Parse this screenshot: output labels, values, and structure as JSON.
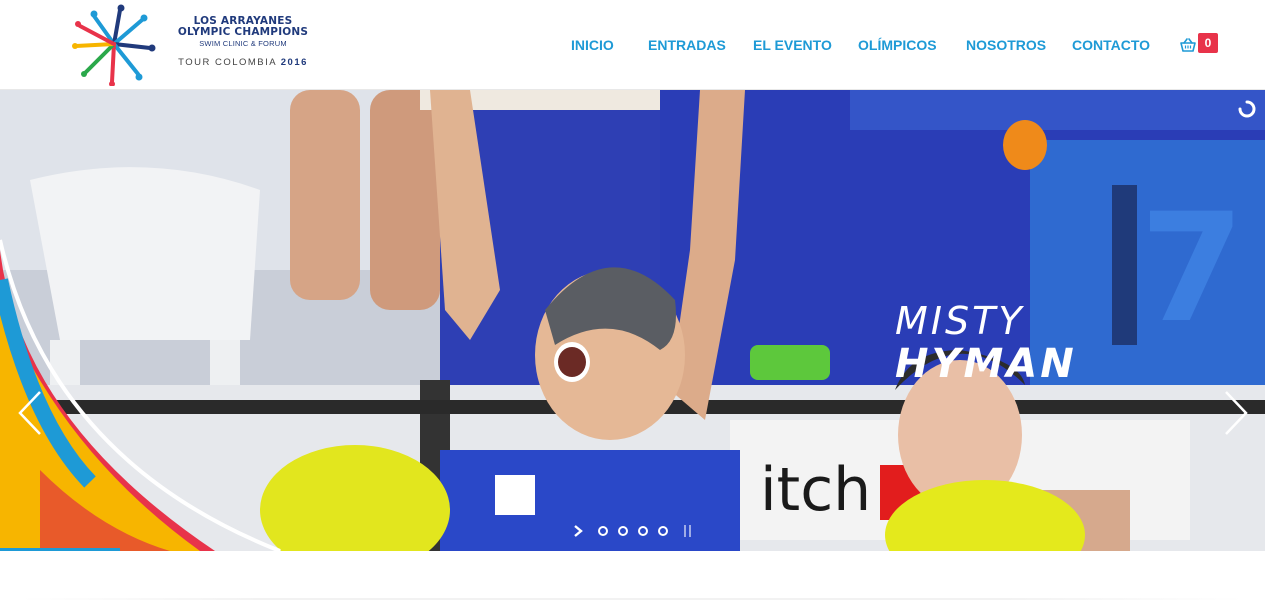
{
  "brand": {
    "line1": "LOS ARRAYANES",
    "line2": "OLYMPIC CHAMPIONS",
    "line3": "SWIM CLINIC & FORUM",
    "line4_tour": "TOUR COLOMBIA",
    "line4_year": "2016"
  },
  "nav": {
    "items": [
      {
        "label": "INICIO"
      },
      {
        "label": "ENTRADAS"
      },
      {
        "label": "EL EVENTO"
      },
      {
        "label": "OLÍMPICOS"
      },
      {
        "label": "NOSOTROS"
      },
      {
        "label": "CONTACTO"
      }
    ],
    "cart_icon": "basket-icon",
    "cart_count": "0"
  },
  "slider": {
    "caption_first": "MISTY",
    "caption_last": "HYMAN",
    "prev_icon": "chevron-left-icon",
    "next_icon": "chevron-right-icon",
    "loading_icon": "spinner-icon",
    "play_icon": "play-icon",
    "pause_icon": "pause-icon",
    "slide_count": 4,
    "active_slide": 1
  },
  "colors": {
    "nav_link": "#1e9ad6",
    "brand_navy": "#203a7c",
    "badge": "#e8334a",
    "pool_blue": "#2c3fb6"
  }
}
